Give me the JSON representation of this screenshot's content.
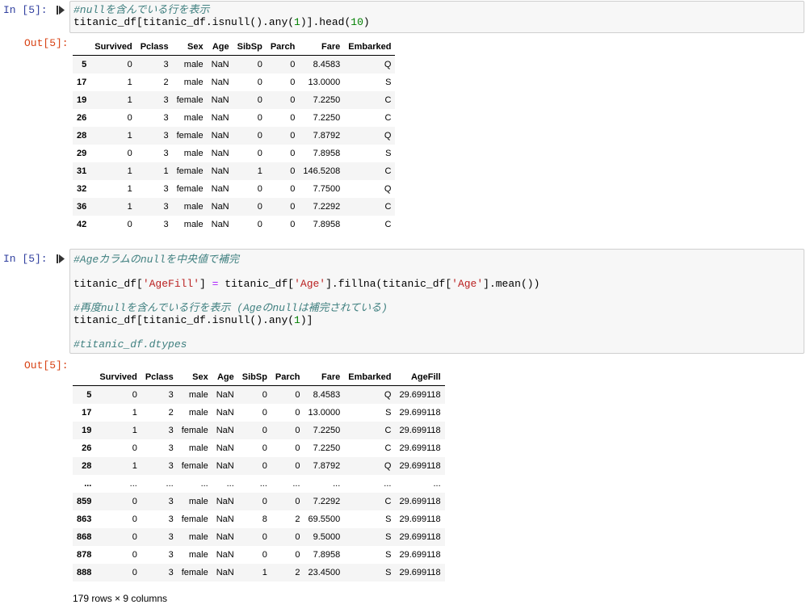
{
  "cell1": {
    "in_prompt": "In [5]:",
    "out_prompt": "Out[5]:",
    "code": {
      "comment": "#nullを含んでいる行を表示",
      "l2_a": "titanic_df[titanic_df.isnull().any(",
      "l2_num1": "1",
      "l2_b": ")].head(",
      "l2_num2": "10",
      "l2_c": ")"
    },
    "columns": [
      "",
      "Survived",
      "Pclass",
      "Sex",
      "Age",
      "SibSp",
      "Parch",
      "Fare",
      "Embarked"
    ],
    "rows": [
      [
        "5",
        "0",
        "3",
        "male",
        "NaN",
        "0",
        "0",
        "8.4583",
        "Q"
      ],
      [
        "17",
        "1",
        "2",
        "male",
        "NaN",
        "0",
        "0",
        "13.0000",
        "S"
      ],
      [
        "19",
        "1",
        "3",
        "female",
        "NaN",
        "0",
        "0",
        "7.2250",
        "C"
      ],
      [
        "26",
        "0",
        "3",
        "male",
        "NaN",
        "0",
        "0",
        "7.2250",
        "C"
      ],
      [
        "28",
        "1",
        "3",
        "female",
        "NaN",
        "0",
        "0",
        "7.8792",
        "Q"
      ],
      [
        "29",
        "0",
        "3",
        "male",
        "NaN",
        "0",
        "0",
        "7.8958",
        "S"
      ],
      [
        "31",
        "1",
        "1",
        "female",
        "NaN",
        "1",
        "0",
        "146.5208",
        "C"
      ],
      [
        "32",
        "1",
        "3",
        "female",
        "NaN",
        "0",
        "0",
        "7.7500",
        "Q"
      ],
      [
        "36",
        "1",
        "3",
        "male",
        "NaN",
        "0",
        "0",
        "7.2292",
        "C"
      ],
      [
        "42",
        "0",
        "3",
        "male",
        "NaN",
        "0",
        "0",
        "7.8958",
        "C"
      ]
    ]
  },
  "cell2": {
    "in_prompt": "In [5]:",
    "out_prompt": "Out[5]:",
    "code": {
      "comment1": "#Ageカラムのnullを中央値で補完",
      "l3_a": "titanic_df[",
      "l3_s1": "'AgeFill'",
      "l3_b": "] ",
      "l3_eq": "=",
      "l3_c": " titanic_df[",
      "l3_s2": "'Age'",
      "l3_d": "].fillna(titanic_df[",
      "l3_s3": "'Age'",
      "l3_e": "].mean())",
      "comment2": "#再度nullを含んでいる行を表示 (Ageのnullは補完されている)",
      "l6_a": "titanic_df[titanic_df.isnull().any(",
      "l6_num": "1",
      "l6_b": ")]",
      "comment3": "#titanic_df.dtypes"
    },
    "columns": [
      "",
      "Survived",
      "Pclass",
      "Sex",
      "Age",
      "SibSp",
      "Parch",
      "Fare",
      "Embarked",
      "AgeFill"
    ],
    "rows": [
      [
        "5",
        "0",
        "3",
        "male",
        "NaN",
        "0",
        "0",
        "8.4583",
        "Q",
        "29.699118"
      ],
      [
        "17",
        "1",
        "2",
        "male",
        "NaN",
        "0",
        "0",
        "13.0000",
        "S",
        "29.699118"
      ],
      [
        "19",
        "1",
        "3",
        "female",
        "NaN",
        "0",
        "0",
        "7.2250",
        "C",
        "29.699118"
      ],
      [
        "26",
        "0",
        "3",
        "male",
        "NaN",
        "0",
        "0",
        "7.2250",
        "C",
        "29.699118"
      ],
      [
        "28",
        "1",
        "3",
        "female",
        "NaN",
        "0",
        "0",
        "7.8792",
        "Q",
        "29.699118"
      ],
      [
        "...",
        "...",
        "...",
        "...",
        "...",
        "...",
        "...",
        "...",
        "...",
        "..."
      ],
      [
        "859",
        "0",
        "3",
        "male",
        "NaN",
        "0",
        "0",
        "7.2292",
        "C",
        "29.699118"
      ],
      [
        "863",
        "0",
        "3",
        "female",
        "NaN",
        "8",
        "2",
        "69.5500",
        "S",
        "29.699118"
      ],
      [
        "868",
        "0",
        "3",
        "male",
        "NaN",
        "0",
        "0",
        "9.5000",
        "S",
        "29.699118"
      ],
      [
        "878",
        "0",
        "3",
        "male",
        "NaN",
        "0",
        "0",
        "7.8958",
        "S",
        "29.699118"
      ],
      [
        "888",
        "0",
        "3",
        "female",
        "NaN",
        "1",
        "2",
        "23.4500",
        "S",
        "29.699118"
      ]
    ],
    "footer": "179 rows × 9 columns"
  }
}
